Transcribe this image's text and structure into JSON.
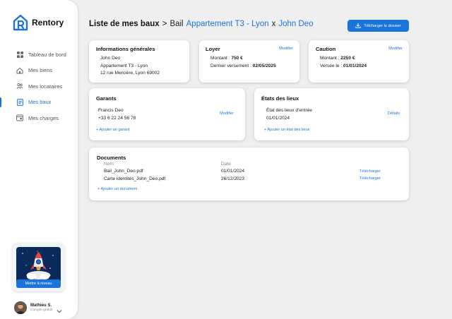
{
  "app": {
    "name": "Rentory"
  },
  "sidebar": {
    "items": [
      {
        "label": "Tableau de bord",
        "icon": "grid-icon",
        "active": false
      },
      {
        "label": "Mes biens",
        "icon": "home-icon",
        "active": false
      },
      {
        "label": "Mes locataires",
        "icon": "users-icon",
        "active": false
      },
      {
        "label": "Mes baux",
        "icon": "document-icon",
        "active": true
      },
      {
        "label": "Mes charges",
        "icon": "receipt-icon",
        "active": false
      }
    ],
    "upgrade_label": "Mettre à niveau"
  },
  "user": {
    "name": "Mathieu S.",
    "plan": "Compte gratuit"
  },
  "header": {
    "root": "Liste de mes baux",
    "sep": ">",
    "prefix": "Bail",
    "property": "Appartement T3 - Lyon",
    "x": "x",
    "tenant": "John Deo",
    "download_label": "Télcharger le dossier"
  },
  "general": {
    "title": "Informations générales",
    "name": "John Deo",
    "property": "Appartement T3 - Lyon",
    "address": "12 rue Mercière, Lyon 69002"
  },
  "rent": {
    "title": "Loyer",
    "edit": "Modifier",
    "amount_label": "Montant :",
    "amount": "750 €",
    "last_label": "Dernier versement :",
    "last_date": "02/05/2025"
  },
  "deposit": {
    "title": "Caution",
    "edit": "Modifier",
    "amount_label": "Montant :",
    "amount": "2250 €",
    "paid_label": "Versée le :",
    "paid_date": "01/01/2024"
  },
  "guarantors": {
    "title": "Garants",
    "name": "Francis Deo",
    "phone": "+33 6 22 24 56 78",
    "edit": "Modifier",
    "add": "+ Ajouter un garant"
  },
  "inventory": {
    "title": "États des lieux",
    "label": "État des lieux d'entrée",
    "date": "01/01/2024",
    "details": "Détails",
    "add": "+ Ajouter un état des lieux"
  },
  "documents": {
    "title": "Documents",
    "col_name": "Nom",
    "col_date": "Date",
    "rows": [
      {
        "name": "Bail_John_Deo.pdf",
        "date": "01/01/2024",
        "action": "Télécharger"
      },
      {
        "name": "Carte identités_John_Deo.pdf",
        "date": "26/12/2023",
        "action": "Télécharger"
      }
    ],
    "add": "+ Ajouter un document"
  }
}
